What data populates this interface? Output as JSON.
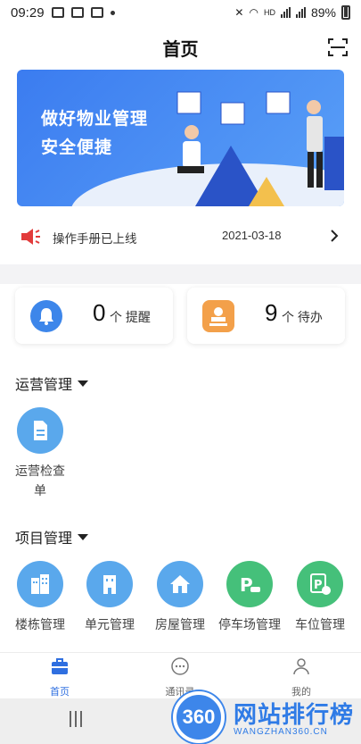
{
  "status_bar": {
    "time": "09:29",
    "battery": "89%",
    "network_label": "HD"
  },
  "header": {
    "title": "首页",
    "scan_icon": "scan-icon"
  },
  "banner": {
    "line1": "做好物业管理",
    "line2": "安全便捷"
  },
  "notice": {
    "icon": "speaker-icon",
    "text": "操作手册已上线",
    "date": "2021-03-18"
  },
  "summary": {
    "reminders": {
      "count": "0",
      "unit": "个 提醒",
      "icon": "bell-icon",
      "color": "#3d86ea"
    },
    "todos": {
      "count": "9",
      "unit": "个 待办",
      "icon": "stamp-icon",
      "color": "#f3a04a"
    }
  },
  "sections": {
    "operations": {
      "title": "运营管理",
      "items": [
        {
          "label": "运营检查\n单",
          "icon": "document-icon"
        }
      ]
    },
    "projects": {
      "title": "项目管理",
      "items": [
        {
          "label": "楼栋管理",
          "icon": "building-icon",
          "color": "#5aa8ec"
        },
        {
          "label": "单元管理",
          "icon": "unit-icon",
          "color": "#5aa8ec"
        },
        {
          "label": "房屋管理",
          "icon": "house-icon",
          "color": "#5aa8ec"
        },
        {
          "label": "停车场管理",
          "icon": "parking-icon",
          "color": "#45c07a"
        },
        {
          "label": "车位管理",
          "icon": "parking-space-icon",
          "color": "#45c07a"
        }
      ]
    }
  },
  "tabs": [
    {
      "label": "首页",
      "icon": "home-briefcase-icon",
      "active": true
    },
    {
      "label": "通讯录",
      "icon": "chat-icon",
      "active": false
    },
    {
      "label": "我的",
      "icon": "user-icon",
      "active": false
    }
  ],
  "watermark": {
    "logo_text": "360",
    "title": "网站排行榜",
    "url": "WANGZHAN360.CN"
  },
  "colors": {
    "accent": "#2f6fe0",
    "banner": "#3b7cf0",
    "blue_tile": "#5aa8ec",
    "green_tile": "#45c07a"
  }
}
